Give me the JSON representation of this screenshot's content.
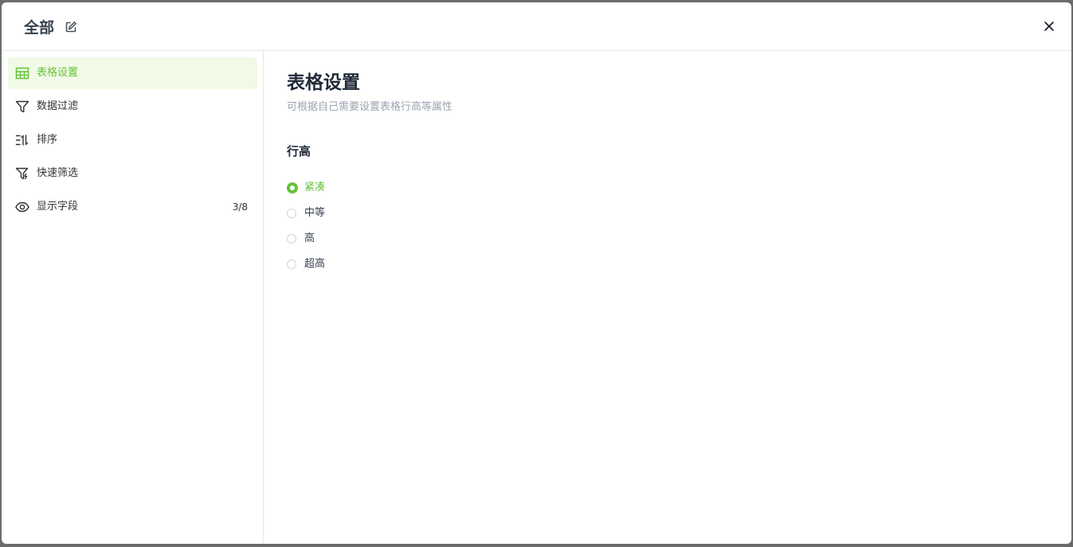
{
  "header": {
    "title": "全部"
  },
  "sidebar": {
    "items": [
      {
        "label": "表格设置",
        "icon": "table-icon",
        "active": true
      },
      {
        "label": "数据过滤",
        "icon": "filter-icon"
      },
      {
        "label": "排序",
        "icon": "sort-icon"
      },
      {
        "label": "快速筛选",
        "icon": "quick-filter-icon"
      },
      {
        "label": "显示字段",
        "icon": "eye-icon",
        "count": "3/8"
      }
    ]
  },
  "main": {
    "title": "表格设置",
    "subtitle": "可根据自己需要设置表格行高等属性",
    "section_title": "行高",
    "row_height_options": [
      {
        "label": "紧凑",
        "checked": true
      },
      {
        "label": "中等",
        "checked": false
      },
      {
        "label": "高",
        "checked": false
      },
      {
        "label": "超高",
        "checked": false
      }
    ]
  },
  "colors": {
    "accent": "#67c23a",
    "active_bg": "#f1fae6"
  }
}
